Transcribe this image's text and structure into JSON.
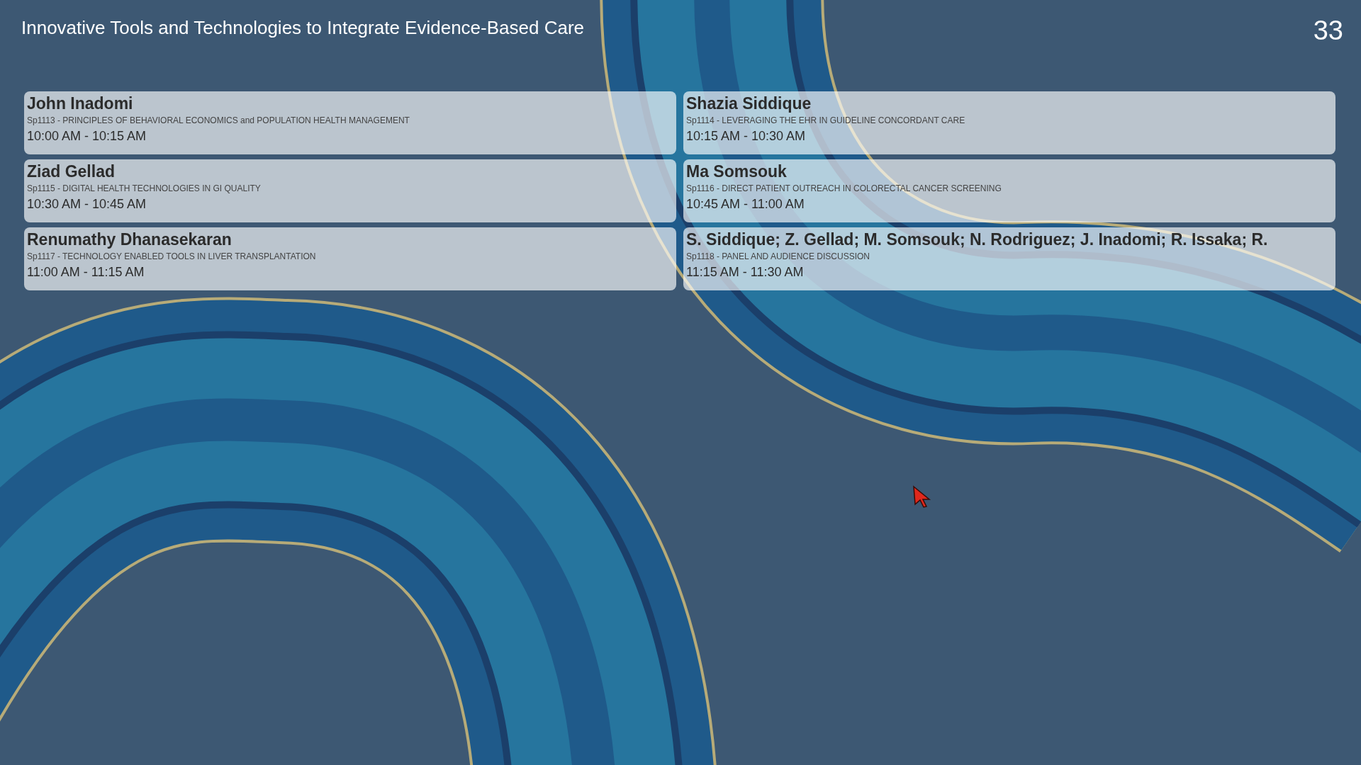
{
  "title": "Innovative Tools and Technologies to Integrate Evidence-Based Care",
  "page_number": "33",
  "sessions": [
    {
      "speaker": "John Inadomi",
      "session": "Sp1113 - PRINCIPLES OF BEHAVIORAL ECONOMICS and POPULATION HEALTH MANAGEMENT",
      "time": "10:00 AM - 10:15 AM"
    },
    {
      "speaker": "Shazia Siddique",
      "session": "Sp1114 - LEVERAGING THE EHR IN GUIDELINE CONCORDANT CARE",
      "time": "10:15 AM - 10:30 AM"
    },
    {
      "speaker": "Ziad Gellad",
      "session": "Sp1115 - DIGITAL HEALTH TECHNOLOGIES IN GI QUALITY",
      "time": "10:30 AM - 10:45 AM"
    },
    {
      "speaker": "Ma Somsouk",
      "session": "Sp1116 - DIRECT PATIENT OUTREACH IN COLORECTAL CANCER SCREENING",
      "time": "10:45 AM - 11:00 AM"
    },
    {
      "speaker": "Renumathy Dhanasekaran",
      "session": "Sp1117 - TECHNOLOGY ENABLED TOOLS IN LIVER TRANSPLANTATION",
      "time": "11:00 AM - 11:15 AM"
    },
    {
      "speaker": "S. Siddique; Z. Gellad; M. Somsouk; N. Rodriguez; J. Inadomi; R. Issaka; R.",
      "session": "Sp1118 - PANEL AND AUDIENCE DISCUSSION",
      "time": "11:15 AM - 11:30 AM"
    }
  ]
}
